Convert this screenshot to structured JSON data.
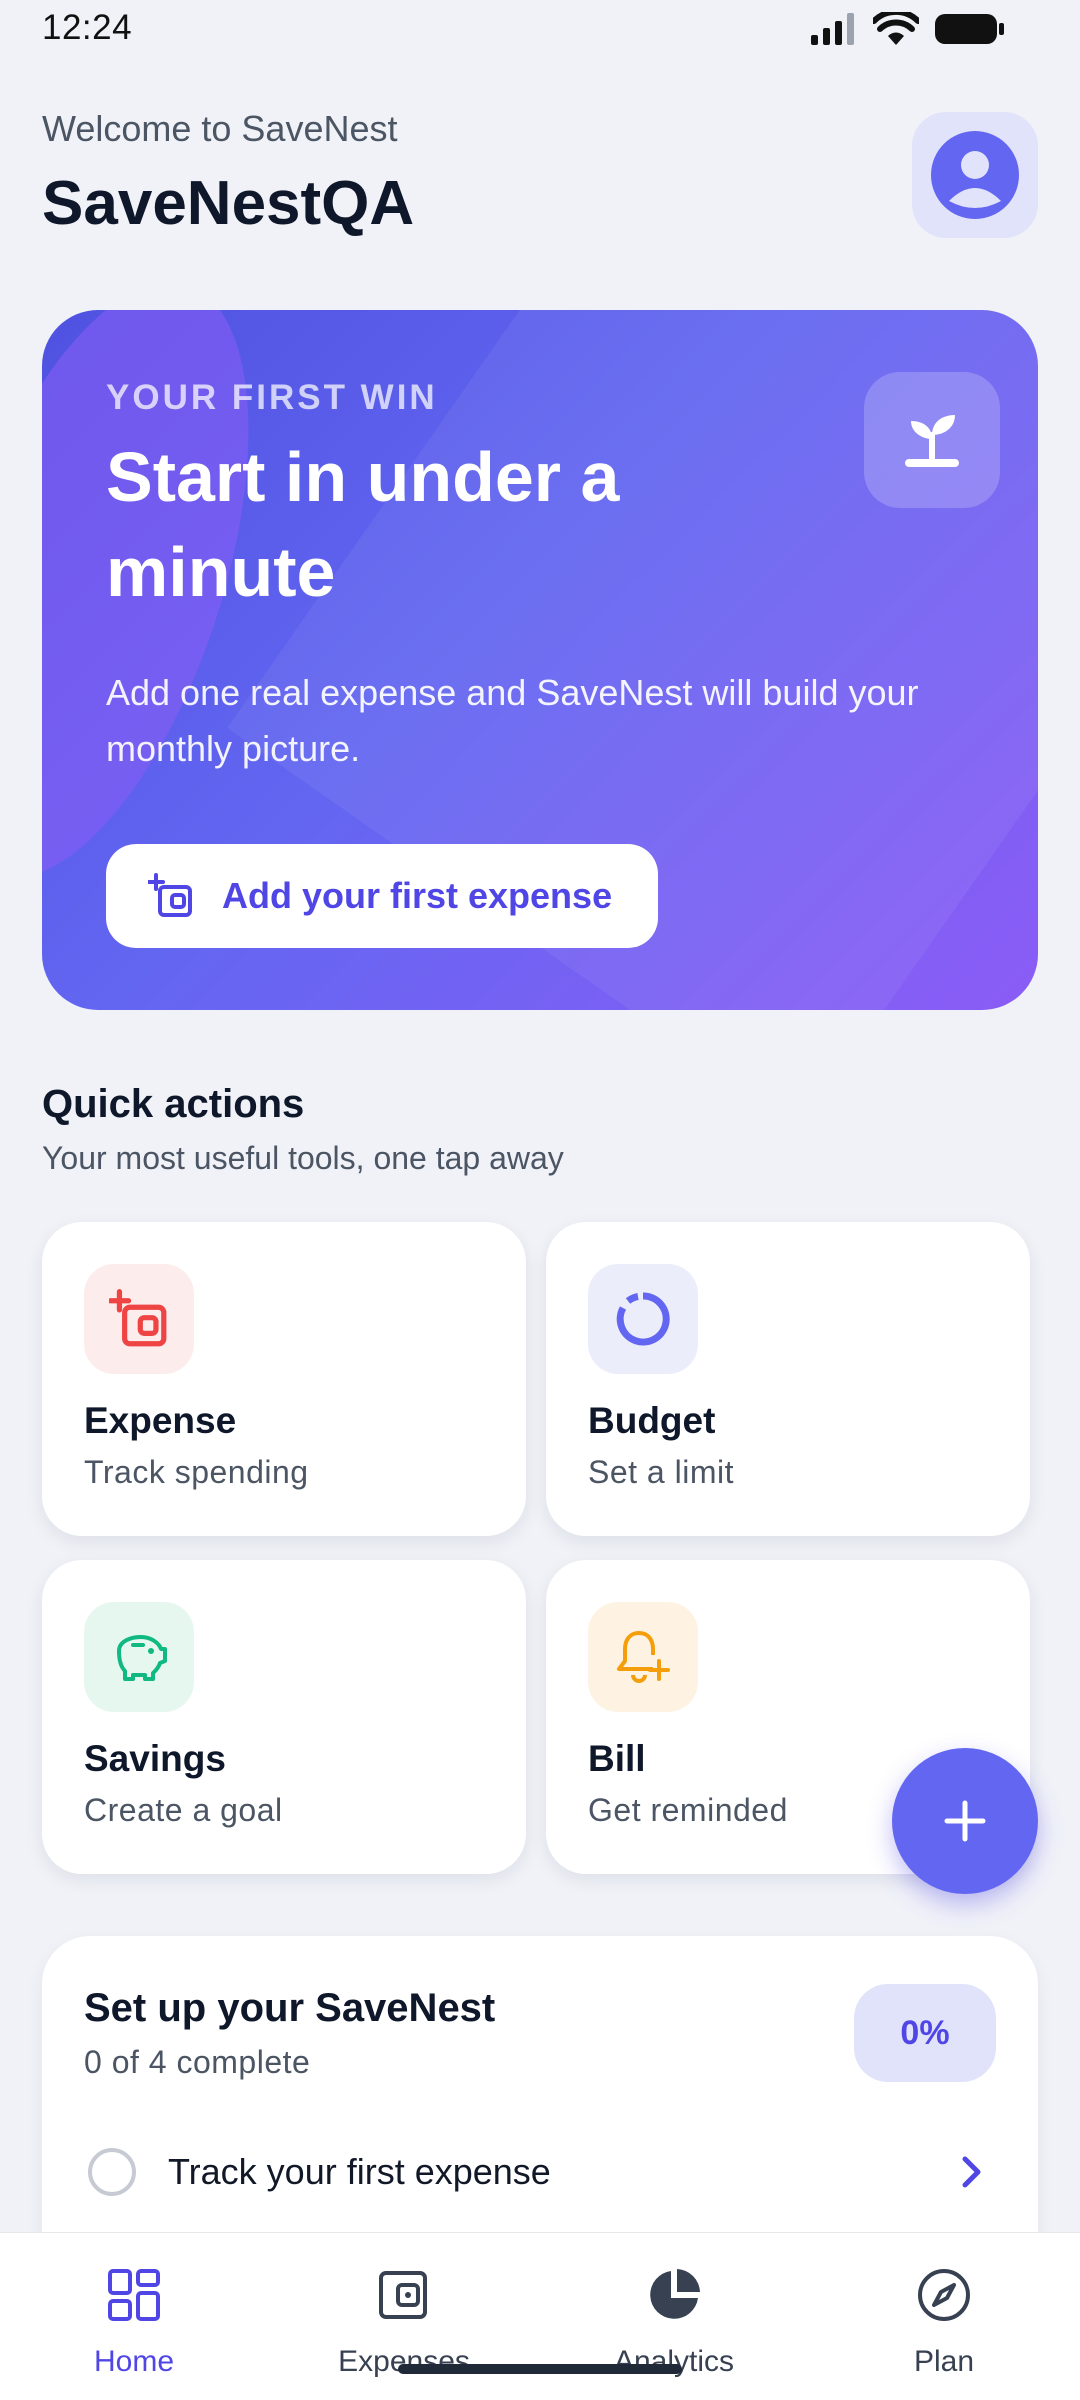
{
  "status_bar": {
    "time": "12:24",
    "icons": [
      "signal-icon",
      "wifi-icon",
      "battery-icon"
    ]
  },
  "header": {
    "welcome": "Welcome to SaveNest",
    "app_name": "SaveNestQA",
    "avatar_icon": "user-circle-icon"
  },
  "hero": {
    "eyebrow": "YOUR FIRST WIN",
    "title": "Start in under a minute",
    "description": "Add one real expense and SaveNest will build your monthly picture.",
    "badge_icon": "sprout-icon",
    "cta_label": "Add your first expense",
    "cta_icon": "add-wallet-icon"
  },
  "quick_actions": {
    "title": "Quick actions",
    "subtitle": "Your most useful tools, one tap away",
    "items": [
      {
        "title": "Expense",
        "subtitle": "Track spending",
        "icon": "add-wallet-icon",
        "icon_color": "#EF4444",
        "bg": "#FDECEC"
      },
      {
        "title": "Budget",
        "subtitle": "Set a limit",
        "icon": "donut-icon",
        "icon_color": "#6366F1",
        "bg": "#ECEDFB"
      },
      {
        "title": "Savings",
        "subtitle": "Create a goal",
        "icon": "piggy-bank-icon",
        "icon_color": "#10B981",
        "bg": "#E6F7F0"
      },
      {
        "title": "Bill",
        "subtitle": "Get reminded",
        "icon": "bell-plus-icon",
        "icon_color": "#F59E0B",
        "bg": "#FEF3E2"
      }
    ]
  },
  "fab": {
    "icon": "plus-icon"
  },
  "setup": {
    "title": "Set up your SaveNest",
    "subtitle": "0 of 4 complete",
    "percent": "0%",
    "tasks": [
      {
        "label": "Track your first expense"
      }
    ]
  },
  "nav": {
    "items": [
      {
        "label": "Home",
        "icon": "home-grid-icon",
        "active": true
      },
      {
        "label": "Expenses",
        "icon": "wallet-icon",
        "active": false
      },
      {
        "label": "Analytics",
        "icon": "pie-chart-icon",
        "active": false
      },
      {
        "label": "Plan",
        "icon": "compass-icon",
        "active": false
      }
    ]
  },
  "colors": {
    "accent": "#6366F1",
    "accent_dark": "#4F46E5",
    "background": "#F0F2F8",
    "hero_gradient_start": "#4F52E0",
    "hero_gradient_end": "#8B5CF6"
  }
}
